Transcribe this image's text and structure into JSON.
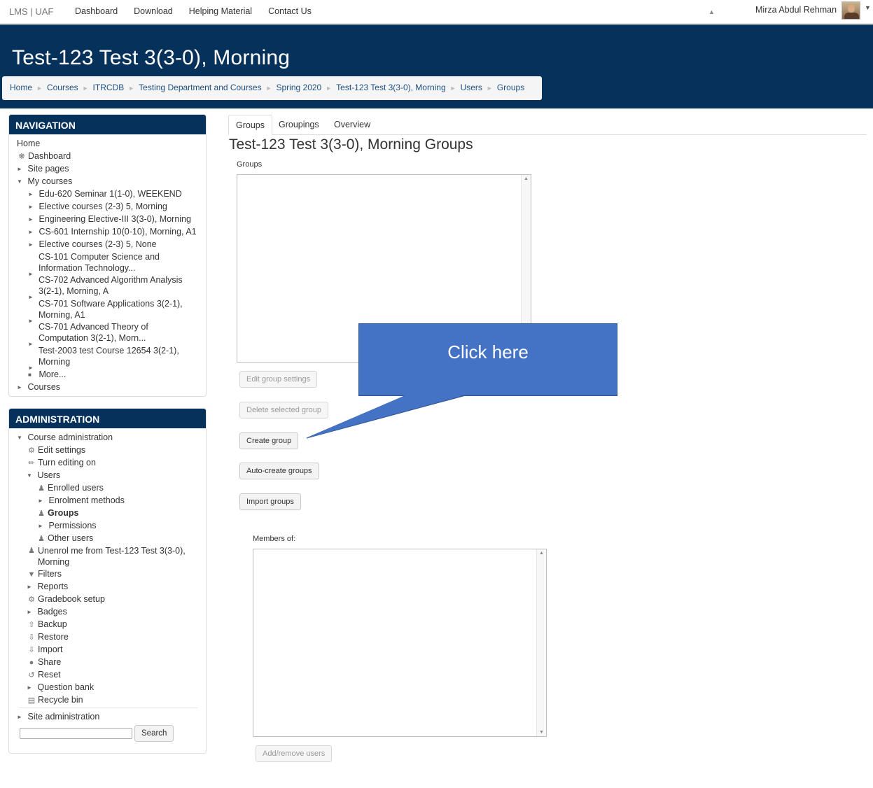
{
  "topbar": {
    "brand": "LMS | UAF",
    "nav": [
      "Dashboard",
      "Download",
      "Helping Material",
      "Contact Us"
    ],
    "user_name": "Mirza Abdul Rehman"
  },
  "header": {
    "title": "Test-123 Test 3(3-0), Morning",
    "breadcrumb": [
      "Home",
      "Courses",
      "ITRCDB",
      "Testing Department and Courses",
      "Spring 2020",
      "Test-123 Test 3(3-0), Morning",
      "Users",
      "Groups"
    ]
  },
  "navigation": {
    "title": "NAVIGATION",
    "home": "Home",
    "dashboard": "Dashboard",
    "site_pages": "Site pages",
    "my_courses": "My courses",
    "courses_list": [
      "Edu-620 Seminar 1(1-0), WEEKEND",
      "Elective courses (2-3) 5, Morning",
      "Engineering Elective-III 3(3-0), Morning",
      "CS-601 Internship 10(0-10), Morning, A1",
      "Elective courses (2-3) 5, None",
      "CS-101 Computer Science and Information Technology...",
      "CS-702 Advanced Algorithm Analysis 3(2-1), Morning, A",
      "CS-701 Software Applications 3(2-1), Morning, A1",
      "CS-701 Advanced Theory of Computation 3(2-1), Morn...",
      "Test-2003 test Course 12654 3(2-1), Morning"
    ],
    "more": "More...",
    "courses": "Courses"
  },
  "administration": {
    "title": "ADMINISTRATION",
    "course_admin": "Course administration",
    "edit_settings": "Edit settings",
    "turn_editing_on": "Turn editing on",
    "users": "Users",
    "enrolled_users": "Enrolled users",
    "enrolment_methods": "Enrolment methods",
    "groups": "Groups",
    "permissions": "Permissions",
    "other_users": "Other users",
    "unenrol": "Unenrol me from Test-123 Test 3(3-0), Morning",
    "filters": "Filters",
    "reports": "Reports",
    "gradebook_setup": "Gradebook setup",
    "badges": "Badges",
    "backup": "Backup",
    "restore": "Restore",
    "import": "Import",
    "share": "Share",
    "reset": "Reset",
    "question_bank": "Question bank",
    "recycle_bin": "Recycle bin",
    "site_admin": "Site administration",
    "search_button": "Search"
  },
  "main": {
    "tabs": [
      "Groups",
      "Groupings",
      "Overview"
    ],
    "heading": "Test-123 Test 3(3-0), Morning Groups",
    "groups_label": "Groups",
    "buttons": {
      "edit_group_settings": "Edit group settings",
      "delete_selected_group": "Delete selected group",
      "create_group": "Create group",
      "auto_create_groups": "Auto-create groups",
      "import_groups": "Import groups",
      "add_remove_users": "Add/remove users"
    },
    "members_label": "Members of:"
  },
  "callout": {
    "text": "Click here",
    "color": "#4472c4"
  },
  "colors": {
    "header_bg": "#06315a",
    "link": "#1d4f80"
  }
}
